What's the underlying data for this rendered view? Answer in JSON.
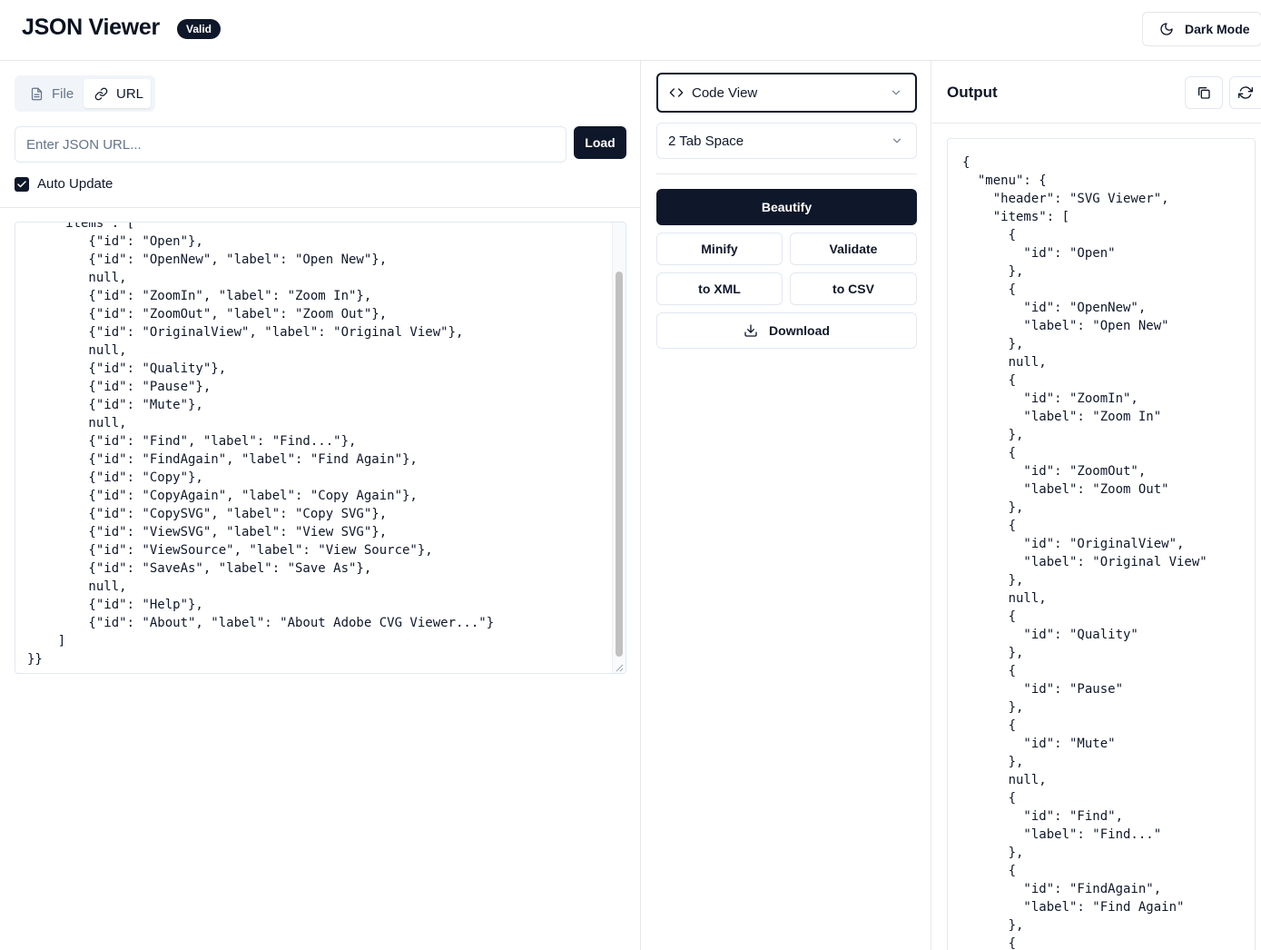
{
  "header": {
    "title": "JSON Viewer",
    "badge": "Valid",
    "dark_mode_label": "Dark Mode"
  },
  "input_panel": {
    "tabs": [
      {
        "label": "File",
        "icon": "file-icon",
        "active": false
      },
      {
        "label": "URL",
        "icon": "link-icon",
        "active": true
      }
    ],
    "url_input": {
      "placeholder": "Enter JSON URL...",
      "value": ""
    },
    "load_label": "Load",
    "auto_update": {
      "label": "Auto Update",
      "checked": true
    },
    "editor_text": "    \"items\": [\n        {\"id\": \"Open\"},\n        {\"id\": \"OpenNew\", \"label\": \"Open New\"},\n        null,\n        {\"id\": \"ZoomIn\", \"label\": \"Zoom In\"},\n        {\"id\": \"ZoomOut\", \"label\": \"Zoom Out\"},\n        {\"id\": \"OriginalView\", \"label\": \"Original View\"},\n        null,\n        {\"id\": \"Quality\"},\n        {\"id\": \"Pause\"},\n        {\"id\": \"Mute\"},\n        null,\n        {\"id\": \"Find\", \"label\": \"Find...\"},\n        {\"id\": \"FindAgain\", \"label\": \"Find Again\"},\n        {\"id\": \"Copy\"},\n        {\"id\": \"CopyAgain\", \"label\": \"Copy Again\"},\n        {\"id\": \"CopySVG\", \"label\": \"Copy SVG\"},\n        {\"id\": \"ViewSVG\", \"label\": \"View SVG\"},\n        {\"id\": \"ViewSource\", \"label\": \"View Source\"},\n        {\"id\": \"SaveAs\", \"label\": \"Save As\"},\n        null,\n        {\"id\": \"Help\"},\n        {\"id\": \"About\", \"label\": \"About Adobe CVG Viewer...\"}\n    ]\n}}"
  },
  "controls": {
    "view_select": "Code View",
    "indent_select": "2 Tab Space",
    "beautify": "Beautify",
    "minify": "Minify",
    "validate": "Validate",
    "to_xml": "to XML",
    "to_csv": "to CSV",
    "download": "Download"
  },
  "output_panel": {
    "title": "Output",
    "output_text": "{\n  \"menu\": {\n    \"header\": \"SVG Viewer\",\n    \"items\": [\n      {\n        \"id\": \"Open\"\n      },\n      {\n        \"id\": \"OpenNew\",\n        \"label\": \"Open New\"\n      },\n      null,\n      {\n        \"id\": \"ZoomIn\",\n        \"label\": \"Zoom In\"\n      },\n      {\n        \"id\": \"ZoomOut\",\n        \"label\": \"Zoom Out\"\n      },\n      {\n        \"id\": \"OriginalView\",\n        \"label\": \"Original View\"\n      },\n      null,\n      {\n        \"id\": \"Quality\"\n      },\n      {\n        \"id\": \"Pause\"\n      },\n      {\n        \"id\": \"Mute\"\n      },\n      null,\n      {\n        \"id\": \"Find\",\n        \"label\": \"Find...\"\n      },\n      {\n        \"id\": \"FindAgain\",\n        \"label\": \"Find Again\"\n      },\n      {"
  },
  "colors": {
    "primary": "#0f172a",
    "border": "#e2e8f0",
    "muted_text": "#64748b"
  }
}
